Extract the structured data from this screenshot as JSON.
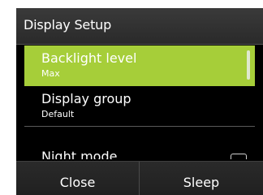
{
  "dialog": {
    "title": "Display Setup"
  },
  "menu": {
    "items": [
      {
        "label": "Backlight level",
        "value": "Max",
        "selected": true
      },
      {
        "label": "Display group",
        "value": "Default",
        "selected": false
      },
      {
        "label": "Night mode",
        "value": "",
        "selected": false,
        "checkbox": true,
        "checked": false
      }
    ]
  },
  "footer": {
    "close_label": "Close",
    "sleep_label": "Sleep"
  },
  "colors": {
    "highlight": "#a6ce39",
    "background": "#000000",
    "header_bg": "#333333",
    "text": "#ffffff"
  }
}
